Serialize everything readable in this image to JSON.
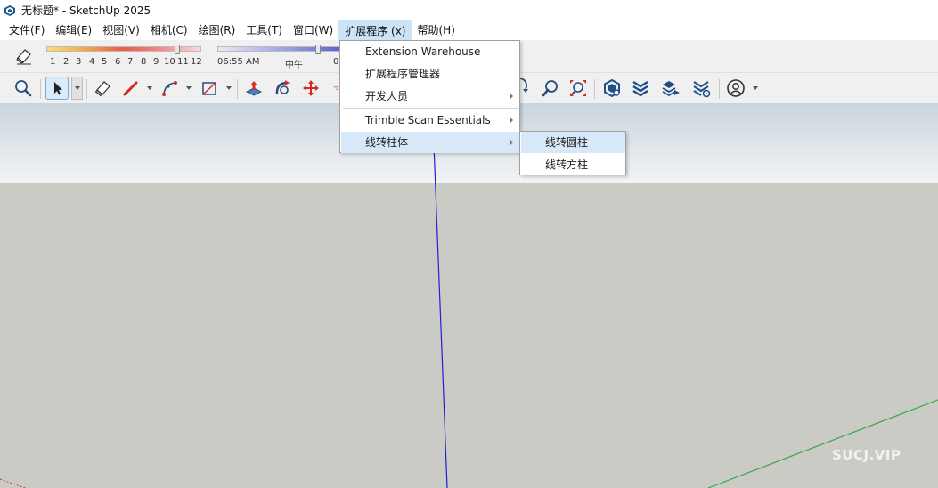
{
  "window": {
    "title": "无标题* - SketchUp 2025"
  },
  "menubar": {
    "items": [
      {
        "label": "文件(F)"
      },
      {
        "label": "编辑(E)"
      },
      {
        "label": "视图(V)"
      },
      {
        "label": "相机(C)"
      },
      {
        "label": "绘图(R)"
      },
      {
        "label": "工具(T)"
      },
      {
        "label": "窗口(W)"
      },
      {
        "label": "扩展程序 (x)"
      },
      {
        "label": "帮助(H)"
      }
    ]
  },
  "shadows": {
    "months": [
      "1",
      "2",
      "3",
      "4",
      "5",
      "6",
      "7",
      "8",
      "9",
      "10",
      "11",
      "12"
    ],
    "time_start": "06:55 AM",
    "time_noon": "中午",
    "time_end_partial": "0"
  },
  "extensions_menu": {
    "items": [
      {
        "label": "Extension Warehouse"
      },
      {
        "label": "扩展程序管理器"
      },
      {
        "label": "开发人员"
      },
      {
        "label": "Trimble Scan Essentials"
      },
      {
        "label": "线转柱体"
      }
    ]
  },
  "submenu": {
    "items": [
      {
        "label": "线转圆柱"
      },
      {
        "label": "线转方柱"
      }
    ]
  },
  "watermark": "SUCJ.VIP",
  "colors": {
    "menu_highlight": "#cce4f7",
    "blue_axis": "#1f1fd6",
    "green_axis": "#3aa84a",
    "red_axis": "#c23a3a"
  }
}
